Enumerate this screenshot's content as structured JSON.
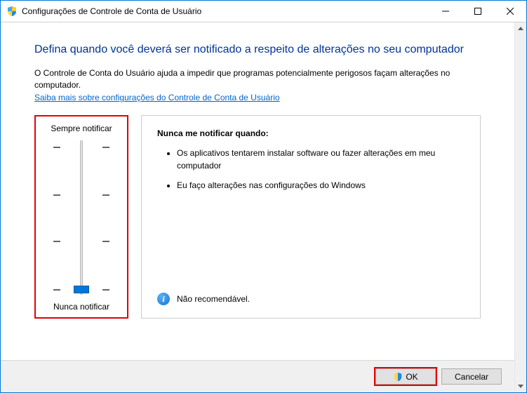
{
  "window": {
    "title": "Configurações de Controle de Conta de Usuário"
  },
  "heading": "Defina quando você deverá ser notificado a respeito de alterações no seu computador",
  "subtext": "O Controle de Conta do Usuário ajuda a impedir que programas potencialmente perigosos façam alterações no computador.",
  "link": "Saiba mais sobre configurações do Controle de Conta de Usuário",
  "slider": {
    "top_label": "Sempre notificar",
    "bottom_label": "Nunca notificar",
    "levels": 4,
    "current_level": 0
  },
  "info_panel": {
    "title": "Nunca me notificar quando:",
    "items": [
      "Os aplicativos tentarem instalar software ou fazer alterações em meu computador",
      "Eu faço alterações nas configurações do Windows"
    ],
    "footer_text": "Não recomendável."
  },
  "buttons": {
    "ok": "OK",
    "cancel": "Cancelar"
  },
  "icons": {
    "info_glyph": "i"
  }
}
